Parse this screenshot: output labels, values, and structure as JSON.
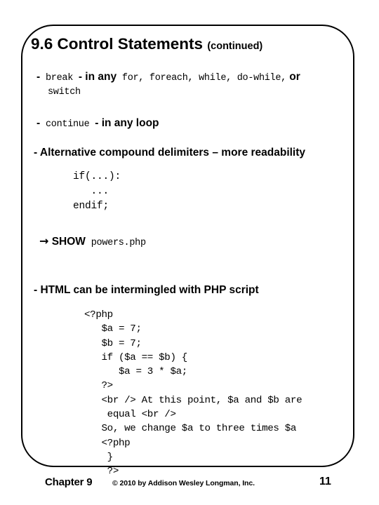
{
  "slide": {
    "title": {
      "main": "9.6 Control Statements",
      "sub": "(continued)"
    },
    "bullets": {
      "break": {
        "dash": "-",
        "keyword": "break",
        "dash2": "-",
        "emphasis": "in any",
        "keywords_list": "for, foreach, while, do-while,",
        "conjunction": "or",
        "wrap_keyword": "switch"
      },
      "continue": {
        "dash": "-",
        "keyword": "continue",
        "dash2": "-",
        "emphasis": "in any loop"
      },
      "alternative": {
        "text": "- Alternative compound delimiters – more readability"
      },
      "show": {
        "arrow": "arrow-right-icon",
        "arrow_glyph": "→",
        "label": "SHOW",
        "filename": "powers.php"
      },
      "html": {
        "text": "- HTML can be intermingled with PHP script"
      }
    },
    "alt_code": "if(...):\n   ...\nendif;",
    "php_code": "<?php\n   $a = 7;\n   $b = 7;\n   if ($a == $b) {\n      $a = 3 * $a;\n   ?>\n   <br /> At this point, $a and $b are\n    equal <br />\n   So, we change $a to three times $a\n   <?php\n    }\n    ?>"
  },
  "footer": {
    "chapter": "Chapter 9",
    "copyright": "© 2010 by Addison Wesley Longman, Inc.",
    "page_number": "11"
  },
  "colors": {
    "ink": "#000000",
    "background": "#ffffff"
  }
}
